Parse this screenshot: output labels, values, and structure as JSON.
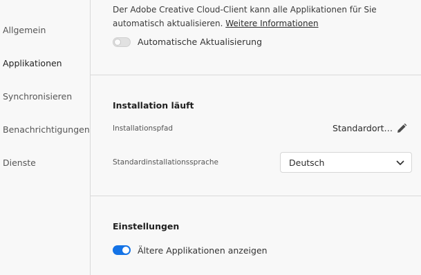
{
  "sidebar": {
    "items": [
      {
        "label": "Allgemein",
        "active": false
      },
      {
        "label": "Applikationen",
        "active": true
      },
      {
        "label": "Synchronisieren",
        "active": false
      },
      {
        "label": "Benachrichtigungen",
        "active": false
      },
      {
        "label": "Dienste",
        "active": false
      }
    ]
  },
  "updates": {
    "description": "Der Adobe Creative Cloud-Client kann alle Applikationen für Sie automatisch aktualisieren.",
    "more_info_link": "Weitere Informationen",
    "auto_update_label": "Automatische Aktualisierung",
    "auto_update_enabled": false
  },
  "installation": {
    "title": "Installation läuft",
    "path_label": "Installationspfad",
    "path_value": "Standardort…",
    "path_edit_icon": "pencil-icon",
    "language_label": "Standardinstallationssprache",
    "language_value": "Deutsch",
    "language_dropdown_icon": "chevron-down-icon"
  },
  "settings": {
    "title": "Einstellungen",
    "show_older_apps_label": "Ältere Applikationen anzeigen",
    "show_older_apps_enabled": true
  },
  "colors": {
    "accent": "#1473e6",
    "background": "#f8f8f8",
    "divider": "#d9d9d9"
  }
}
